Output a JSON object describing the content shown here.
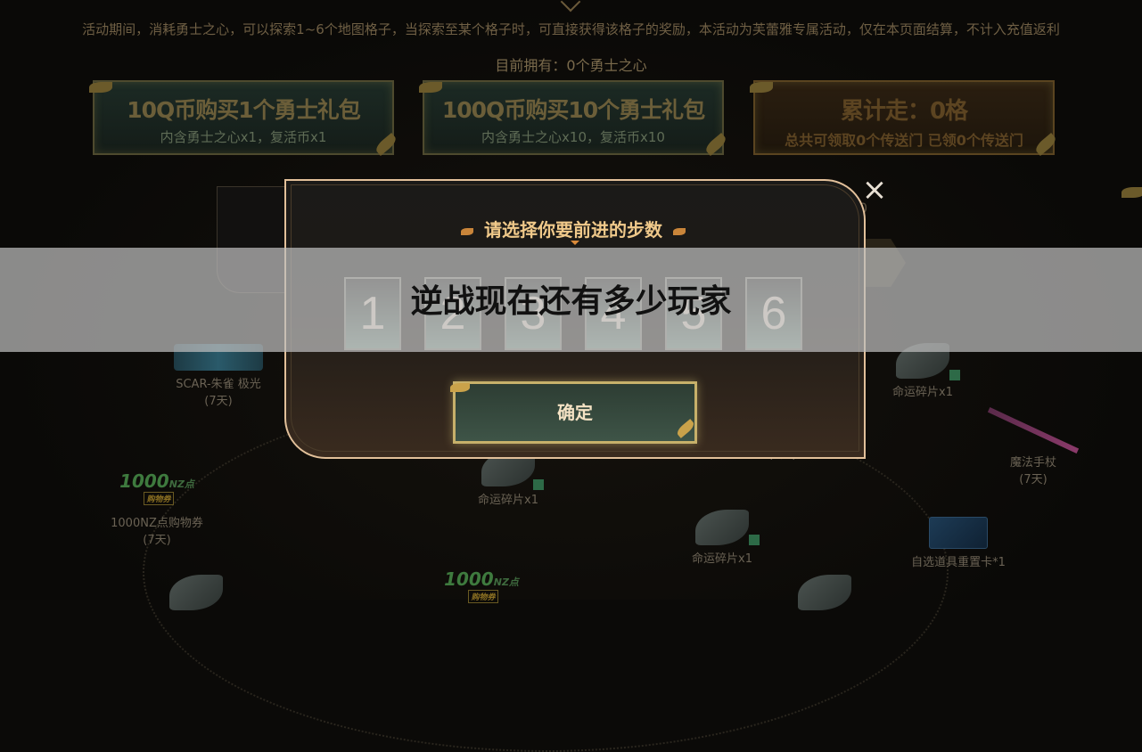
{
  "notice": "活动期间，消耗勇士之心，可以探索1~6个地图格子，当探索至某个格子时，可直接获得该格子的奖励，本活动为芙蕾雅专属活动，仅在本页面结算，不计入充值返利",
  "owned": "目前拥有：0个勇士之心",
  "packs": [
    {
      "title": "10Q币购买1个勇士礼包",
      "subtitle": "内含勇士之心x1，复活币x1"
    },
    {
      "title": "100Q币购买10个勇士礼包",
      "subtitle": "内含勇士之心x10，复活币x10"
    }
  ],
  "progress": {
    "title": "累计走：0格",
    "subtitle": "总共可领取0个传送门 已领0个传送门"
  },
  "side_count": "0",
  "rewards": {
    "scar": {
      "name": "SCAR-朱雀 极光",
      "duration": "(7天)"
    },
    "nz_coupon": {
      "logo": "1000",
      "unit": "NZ点",
      "tag": "购物券",
      "name": "1000NZ点购物券",
      "duration": "(7天)"
    },
    "nz_logo_2": {
      "logo": "1000",
      "unit": "NZ点",
      "tag": "购物券"
    },
    "fragment": "命运碎片x1",
    "staff": {
      "name": "魔法手杖",
      "duration": "(7天)"
    },
    "reset_card": "自选道具重置卡*1",
    "hidden_duration": "(7天)"
  },
  "modal": {
    "title": "请选择你要前进的步数",
    "steps": [
      "1",
      "2",
      "3",
      "4",
      "5",
      "6"
    ],
    "confirm": "确定",
    "close": "×"
  },
  "banner": "逆战现在还有多少玩家"
}
